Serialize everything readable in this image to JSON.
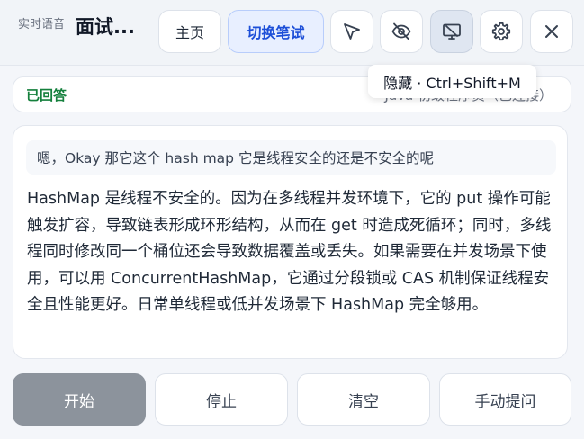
{
  "header": {
    "mode_label": "实时语音",
    "title": "面试...",
    "home_label": "主页",
    "switch_label": "切换笔试"
  },
  "tooltip": {
    "text": "隐藏 · Ctrl+Shift+M"
  },
  "status": {
    "state": "已回答",
    "context": "Java 初级程序员（已连接）"
  },
  "conversation": {
    "question": "嗯，Okay 那它这个 hash map 它是线程安全的还是不安全的呢",
    "answer": "HashMap 是线程不安全的。因为在多线程并发环境下，它的 put 操作可能触发扩容，导致链表形成环形结构，从而在 get 时造成死循环；同时，多线程同时修改同一个桶位还会导致数据覆盖或丢失。如果需要在并发场景下使用，可以用 ConcurrentHashMap，它通过分段锁或 CAS 机制保证线程安全且性能更好。日常单线程或低并发场景下 HashMap 完全够用。"
  },
  "controls": {
    "start_label": "开始",
    "stop_label": "停止",
    "clear_label": "清空",
    "manual_label": "手动提问"
  },
  "icons": {
    "pointer": "cursor-arrow-icon",
    "hide": "eye-off-icon",
    "screen": "monitor-off-icon",
    "settings": "gear-icon",
    "close": "close-icon"
  },
  "colors": {
    "accent": "#1d4fd8",
    "answered": "#15803d",
    "start_button": "#8c939c"
  }
}
